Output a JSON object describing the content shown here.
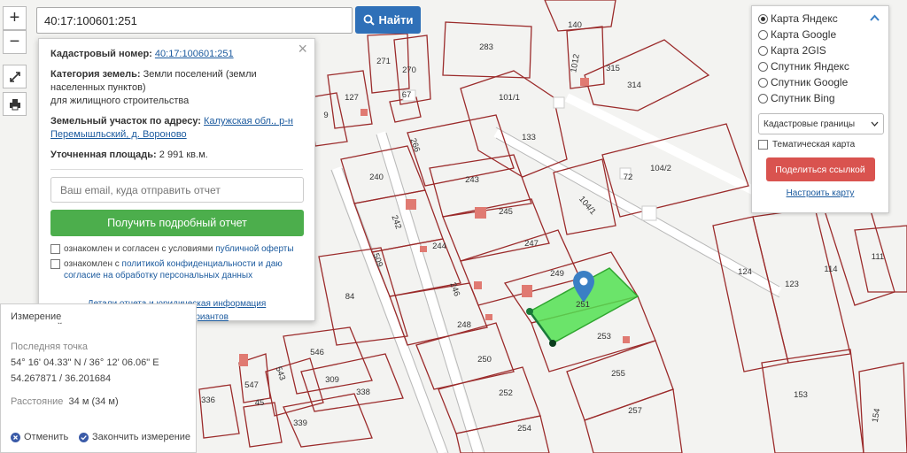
{
  "search": {
    "value": "40:17:100601:251",
    "button": "Найти"
  },
  "zoom": {
    "in": "+",
    "out": "−"
  },
  "popup": {
    "close": "×",
    "cadastral_label": "Кадастровый номер:",
    "cadastral_number": "40:17:100601:251",
    "category_label": "Категория земель:",
    "category_value": "Земли поселений (земли населенных пунктов)",
    "category_purpose": "для жилищного строительства",
    "address_label": "Земельный участок по адресу:",
    "address_value": "Калужская обл., р-н Перемышльский, д. Вороново",
    "area_label": "Уточненная площадь:",
    "area_value": "2 991 кв.м.",
    "email_placeholder": "Ваш email, куда отправить отчет",
    "report_button": "Получить подробный отчет",
    "check1_text": "ознакомлен и согласен с условиями",
    "check1_link": "публичной оферты",
    "check2_text": "ознакомлен с",
    "check2_link": "политикой конфиденциальности и даю согласие на обработку персональных данных",
    "details_link": "Детали отчета и юридическая информация",
    "manual_link": "Ручной выбор вариантов"
  },
  "measure": {
    "title": "Измерение расстояний",
    "last_point_label": "Последняя точка",
    "dms": "54° 16' 04.33\" N / 36° 12' 06.06\" E",
    "decimal": "54.267871 / 36.201684",
    "distance_label": "Расстояние",
    "distance_value": "34 м (34 м)",
    "cancel": "Отменить",
    "finish": "Закончить измерение"
  },
  "layers": {
    "options": [
      "Карта Яндекс",
      "Карта Google",
      "Карта 2GIS",
      "Спутник Яндекс",
      "Спутник Google",
      "Спутник Bing"
    ],
    "selected_index": 0,
    "select_value": "Кадастровые границы",
    "thematic": "Тематическая карта",
    "share": "Поделиться ссылкой",
    "setup": "Настроить карту"
  },
  "map": {
    "colors": {
      "boundary": "#9b2b2b",
      "highlight": "#52e052",
      "pin": "#3a7fc4",
      "building": "#e07a72"
    },
    "parcel_labels": [
      "140",
      "283",
      "1012",
      "271",
      "270",
      "315",
      "314",
      "101/1",
      "127",
      "9",
      "67",
      "133",
      "266",
      "240",
      "243",
      "72",
      "104/2",
      "104/1",
      "242",
      "245",
      "247",
      "244",
      "249",
      "84",
      "246",
      "509",
      "251",
      "253",
      "248",
      "124",
      "123",
      "114",
      "111",
      "546",
      "543",
      "250",
      "255",
      "547",
      "309",
      "338",
      "252",
      "336",
      "257",
      "153",
      "339",
      "254",
      "154",
      "45"
    ]
  }
}
